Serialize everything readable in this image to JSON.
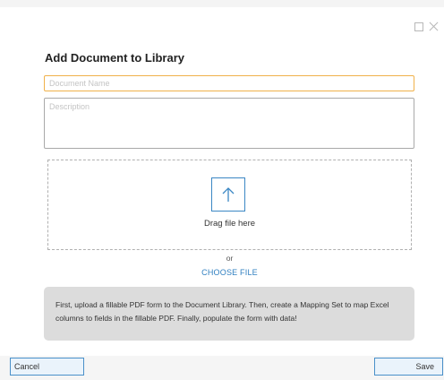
{
  "dialog": {
    "title": "Add Document to Library",
    "window_controls": {
      "maximize_icon": "maximize-icon",
      "close_icon": "close-icon"
    }
  },
  "form": {
    "document_name": {
      "value": "",
      "placeholder": "Document Name"
    },
    "description": {
      "value": "",
      "placeholder": "Description"
    }
  },
  "dropzone": {
    "icon": "upload-arrow-icon",
    "drag_text": "Drag file here",
    "or_text": "or",
    "choose_file_label": "CHOOSE FILE"
  },
  "info": {
    "text": "First, upload a fillable PDF form to the Document Library. Then, create a Mapping Set to map Excel columns to fields in the fillable PDF. Finally, populate the form with data!"
  },
  "footer": {
    "cancel_label": "Cancel",
    "save_label": "Save"
  },
  "colors": {
    "accent": "#2f7fc0",
    "focus_border": "#f0b14a",
    "info_background": "#dcdcdc"
  }
}
